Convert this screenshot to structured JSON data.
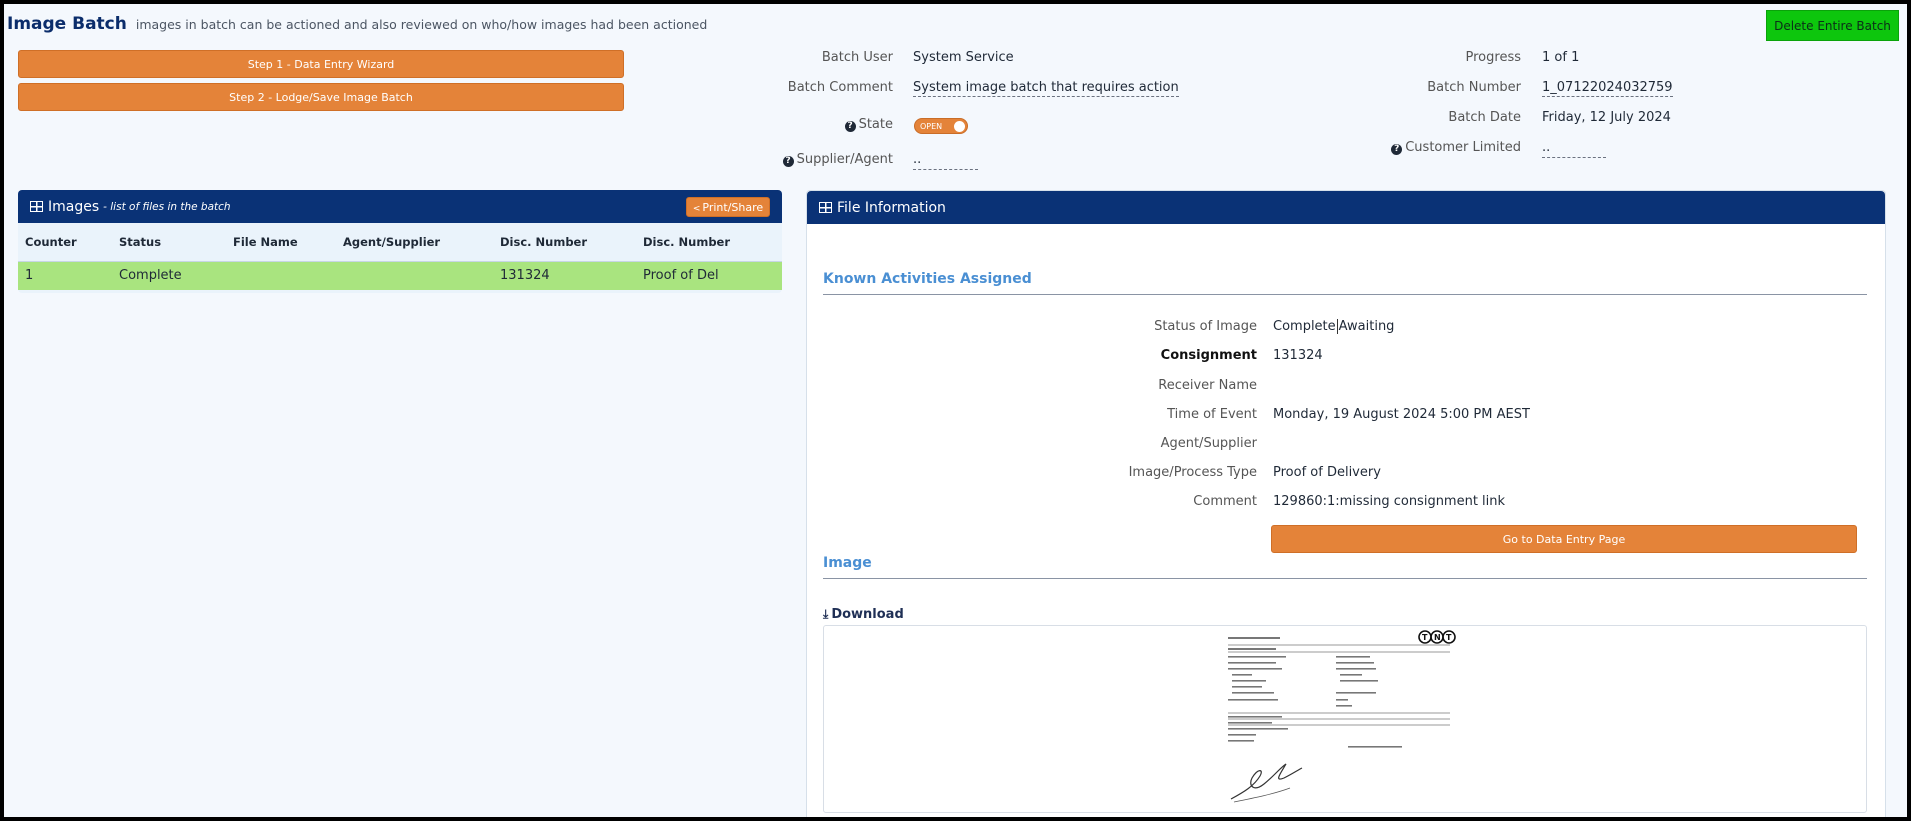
{
  "header": {
    "title": "Image Batch",
    "subtitle": "images in batch can be actioned and also reviewed on who/how images had been actioned",
    "delete_label": "Delete Entire Batch"
  },
  "steps": {
    "step1_label": "Step 1 - Data Entry Wizard",
    "step2_label": "Step 2 - Lodge/Save Image Batch"
  },
  "batch": {
    "user_label": "Batch User",
    "user_value": "System Service",
    "comment_label": "Batch Comment",
    "comment_value": "System image batch that requires action",
    "state_label": "State",
    "state_value": "OPEN",
    "supplier_label": "Supplier/Agent",
    "supplier_value": "..",
    "progress_label": "Progress",
    "progress_value": "1 of 1",
    "number_label": "Batch Number",
    "number_value": "1_07122024032759",
    "date_label": "Batch Date",
    "date_value": "Friday, 12 July 2024",
    "customer_label": "Customer Limited",
    "customer_value": ".."
  },
  "images_panel": {
    "title": "Images",
    "subtitle": "- list of files in the batch",
    "print_label": "Print/Share",
    "columns": [
      "Counter",
      "Status",
      "File Name",
      "Agent/Supplier",
      "Disc. Number",
      "Disc. Number"
    ],
    "rows": [
      [
        "1",
        "Complete",
        "",
        "",
        "131324",
        "Proof of Del"
      ]
    ]
  },
  "file_panel": {
    "title": "File Information",
    "section_activities": "Known Activities Assigned",
    "status_label": "Status of Image",
    "status_value": "Complete",
    "status_value2": "Awaiting",
    "consignment_label": "Consignment",
    "consignment_value": "131324",
    "receiver_label": "Receiver Name",
    "receiver_value": "",
    "time_label": "Time of Event",
    "time_value": "Monday, 19 August 2024 5:00 PM AEST",
    "agent_label": "Agent/Supplier",
    "agent_value": "",
    "type_label": "Image/Process Type",
    "type_value": "Proof of Delivery",
    "comment_label": "Comment",
    "comment_value": "129860:1:missing consignment link",
    "data_entry_label": "Go to Data Entry Page",
    "section_image": "Image",
    "download_label": "Download"
  },
  "colors": {
    "navy": "#0a3276",
    "orange": "#e48339",
    "green_button": "#0dc60d",
    "row_complete": "#a9e47f",
    "section_blue": "#4a8fd3"
  }
}
